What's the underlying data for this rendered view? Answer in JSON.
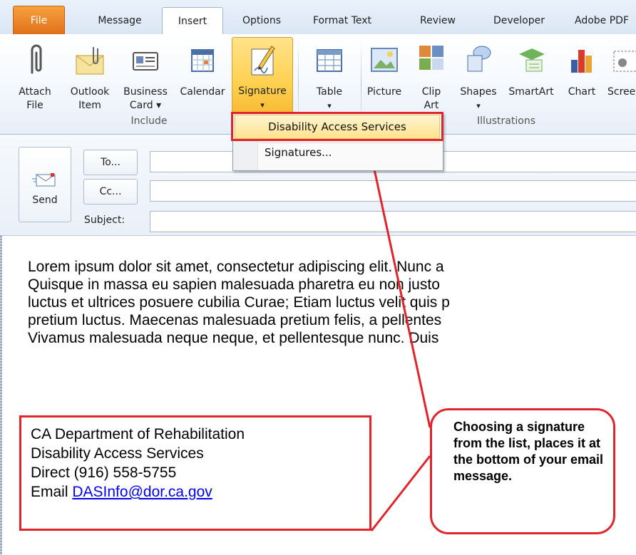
{
  "tabs": [
    "File",
    "Message",
    "Insert",
    "Options",
    "Format Text",
    "Review",
    "Developer",
    "Adobe PDF"
  ],
  "ribbon": {
    "buttons": [
      {
        "label1": "Attach",
        "label2": "File",
        "icon": "paperclip-icon"
      },
      {
        "label1": "Outlook",
        "label2": "Item",
        "icon": "envelope-icon"
      },
      {
        "label1": "Business",
        "label2": "Card ▾",
        "icon": "business-card-icon"
      },
      {
        "label1": "Calendar",
        "label2": "",
        "icon": "calendar-icon"
      },
      {
        "label1": "Signature",
        "label2": "▾",
        "icon": "signature-pen-icon"
      },
      {
        "label1": "Table",
        "label2": "▾",
        "icon": "table-icon"
      },
      {
        "label1": "Picture",
        "label2": "",
        "icon": "picture-icon"
      },
      {
        "label1": "Clip",
        "label2": "Art",
        "icon": "clip-art-icon"
      },
      {
        "label1": "Shapes",
        "label2": "▾",
        "icon": "shapes-icon"
      },
      {
        "label1": "SmartArt",
        "label2": "",
        "icon": "smartart-icon"
      },
      {
        "label1": "Chart",
        "label2": "",
        "icon": "chart-icon"
      },
      {
        "label1": "Screenshot",
        "label2": "▾",
        "icon": "screenshot-icon"
      }
    ],
    "groups": {
      "include": "Include",
      "illustrations": "Illustrations"
    }
  },
  "signature_menu": {
    "items": [
      "Disability Access Services",
      "Signatures..."
    ]
  },
  "compose": {
    "send": "Send",
    "to": "To...",
    "cc": "Cc...",
    "subject": "Subject:"
  },
  "body": {
    "lines": [
      "Lorem ipsum dolor sit amet, consectetur adipiscing elit. Nunc a",
      "Quisque in massa eu sapien malesuada pharetra eu non justo",
      "luctus et ultrices posuere cubilia Curae; Etiam luctus velit quis p",
      "pretium luctus. Maecenas malesuada pretium felis, a pellentes",
      "Vivamus malesuada neque neque, et pellentesque nunc. Duis"
    ],
    "signature": {
      "line1": "CA Department of Rehabilitation",
      "line2": "Disability Access Services",
      "line3": "Direct (916) 558-5755",
      "email_prefix": "Email ",
      "email": "DASInfo@dor.ca.gov"
    }
  },
  "callout": {
    "text": "Choosing a signature from the list, places it at the bottom of your email message."
  },
  "colors": {
    "annotation_red": "#e0242b",
    "file_tab": "#e8781f",
    "selected_button": "#ffd04f",
    "link": "#0000ee"
  }
}
